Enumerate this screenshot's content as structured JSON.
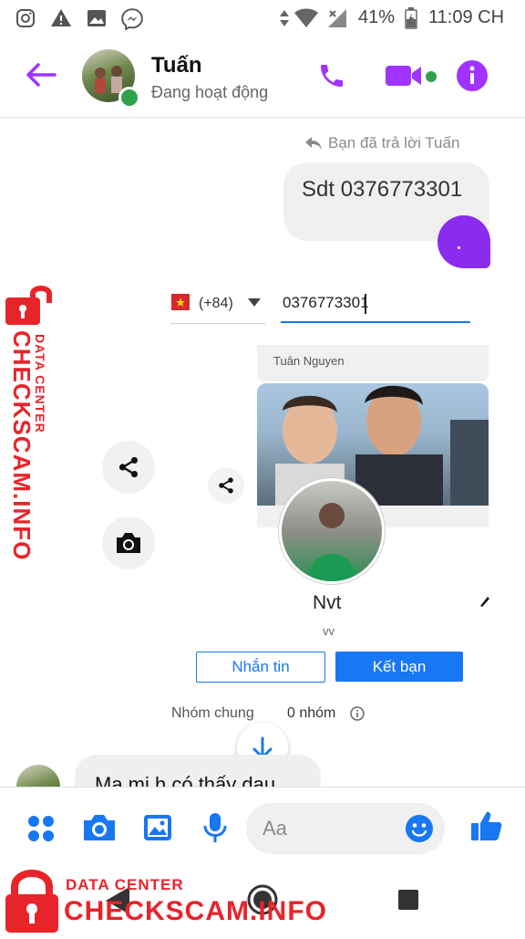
{
  "status_bar": {
    "battery": "41%",
    "time": "11:09 CH"
  },
  "header": {
    "contact_name": "Tuấn",
    "presence": "Đang hoạt động"
  },
  "chat": {
    "reply_label": "Bạn đã trả lời Tuấn",
    "outgoing_message": "Sdt 0376773301",
    "incoming_message": "Ma mi h có thấy dau"
  },
  "shared_screenshot": {
    "country_code": "(+84)",
    "phone_input": "0376773301",
    "post_author": "Tuân Nguyen",
    "profile_name": "Nvt",
    "profile_sub": "vv",
    "message_button": "Nhắn tin",
    "add_friend_button": "Kết bạn",
    "mutual_groups_label": "Nhóm chung",
    "mutual_groups_value": "0 nhóm"
  },
  "composer": {
    "placeholder": "Aa"
  },
  "watermark": {
    "line1": "DATA CENTER",
    "line2": "CHECKSCAM.INFO"
  },
  "colors": {
    "accent": "#a033ff",
    "messenger_blue": "#1877f2",
    "online": "#31a24c",
    "watermark_red": "#e8242b"
  }
}
